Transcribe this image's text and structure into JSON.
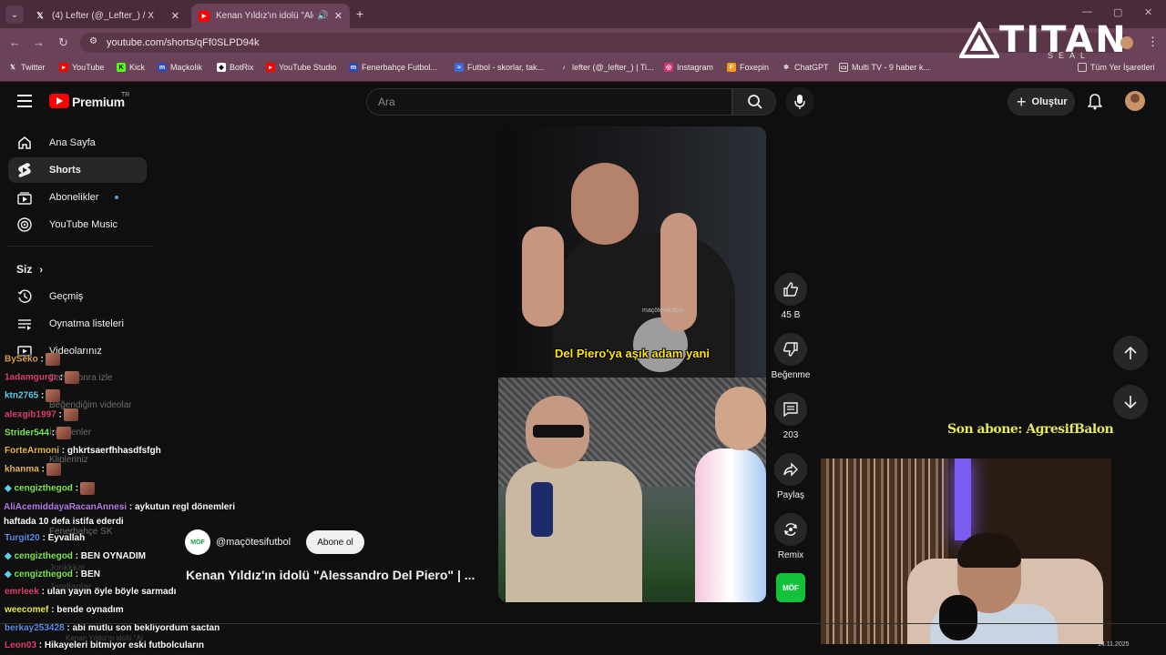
{
  "browser": {
    "tabs": [
      {
        "label": "(4) Lefter (@_Lefter_) / X",
        "favicon": "x-icon"
      },
      {
        "label": "Kenan Yıldız'ın idolü \"Alessa",
        "favicon": "youtube-icon",
        "active": true
      }
    ],
    "url": "youtube.com/shorts/qFf0SLPD94k",
    "bookmarks": [
      {
        "label": "Twitter",
        "icon": "x-icon"
      },
      {
        "label": "YouTube",
        "icon": "youtube-icon"
      },
      {
        "label": "Kick",
        "icon": "kick-icon"
      },
      {
        "label": "Maçkolik",
        "icon": "mackolik-icon"
      },
      {
        "label": "BotRix",
        "icon": "botrix-icon"
      },
      {
        "label": "YouTube Studio",
        "icon": "youtube-icon"
      },
      {
        "label": "Fenerbahçe Futbol...",
        "icon": "mackolik-icon"
      },
      {
        "label": "Futbol - skorlar, tak...",
        "icon": "flashscore-icon"
      },
      {
        "label": "lefter (@_lefter_) | Ti...",
        "icon": "tiktok-icon"
      },
      {
        "label": "Instagram",
        "icon": "instagram-icon"
      },
      {
        "label": "Foxepin",
        "icon": "foxepin-icon"
      },
      {
        "label": "ChatGPT",
        "icon": "chatgpt-icon"
      },
      {
        "label": "Multi TV - 9 haber k...",
        "icon": "multitv-icon"
      }
    ],
    "all_bookmarks": "Tüm Yer İşaretleri"
  },
  "overlay": {
    "brand": "TITAN",
    "brand_sub": "SEAL",
    "last_sub": "Son abone: AgresifBalon"
  },
  "youtube": {
    "logo": "Premium",
    "region": "TR",
    "search_placeholder": "Ara",
    "create_label": "Oluştur",
    "nav": [
      {
        "label": "Ana Sayfa",
        "icon": "home-icon"
      },
      {
        "label": "Shorts",
        "icon": "shorts-icon",
        "active": true
      },
      {
        "label": "Abonelikler",
        "icon": "subscriptions-icon"
      },
      {
        "label": "YouTube Music",
        "icon": "music-icon"
      }
    ],
    "you_header": "Siz",
    "you_items": [
      {
        "label": "Geçmiş",
        "icon": "history-icon"
      },
      {
        "label": "Oynatma listeleri",
        "icon": "playlist-icon"
      },
      {
        "label": "Videolarınız",
        "icon": "videos-icon"
      }
    ],
    "ghost_items": [
      "Daha sonra izle",
      "Beğendiğim videolar",
      "İndirilenler",
      "Klipleriniz",
      "Fenerbahçe SK",
      "Jonkkkar",
      "Jagdlanlar",
      "Kenan Yıldız'ın idolü \"Al"
    ],
    "video": {
      "caption": "Del Piero'ya aşık adam yani",
      "watermark": "maçötesifutbol",
      "channel": "@maçötesifutbol",
      "channel_avatar": "MÖF",
      "subscribe": "Abone ol",
      "title": "Kenan Yıldız'ın idolü \"Alessandro Del Piero\" | ..."
    },
    "actions": [
      {
        "label": "45 B",
        "icon": "like-icon"
      },
      {
        "label": "Beğenme",
        "icon": "dislike-icon"
      },
      {
        "label": "203",
        "icon": "comment-icon"
      },
      {
        "label": "Paylaş",
        "icon": "share-icon"
      },
      {
        "label": "Remix",
        "icon": "remix-icon"
      }
    ]
  },
  "chat": [
    {
      "user": "BySeko",
      "color": "#d9a33a",
      "msg": ":",
      "emote": true
    },
    {
      "user": "1adamgurgr",
      "color": "#e0406c",
      "msg": ":",
      "emote": true
    },
    {
      "user": "ktn2765",
      "color": "#5ad1e8",
      "msg": ":",
      "emote": true
    },
    {
      "user": "alexgib1997",
      "color": "#e0406c",
      "msg": ":",
      "emote": true
    },
    {
      "user": "Strider544",
      "color": "#7ce84a",
      "msg": ":",
      "emote": true
    },
    {
      "user": "ForteArmoni",
      "color": "#e8b84a",
      "msg": ": ghkrtsaerfhhasdfsfgh",
      "emote": false
    },
    {
      "user": "khanma",
      "color": "#e8b84a",
      "msg": ":",
      "emote": true
    },
    {
      "user": "cengizthegod",
      "color": "#7ce84a",
      "msg": ":",
      "emote": true
    },
    {
      "user": "AliAcemiddayaRacanAnnesi",
      "color": "#b77de8",
      "msg": ": aykutun regl dönemleri haftada 10 defa istifa ederdi",
      "emote": false
    },
    {
      "user": "Turgit20",
      "color": "#5a8de8",
      "msg": ": Eyvallah",
      "emote": false
    },
    {
      "user": "cengizthegod",
      "color": "#7ce84a",
      "msg": ": BEN OYNADIM",
      "emote": false
    },
    {
      "user": "cengizthegod",
      "color": "#7ce84a",
      "msg": ": BEN",
      "emote": false
    },
    {
      "user": "emrleek",
      "color": "#e0406c",
      "msg": ": ulan yayın öyle böyle sarmadı",
      "emote": false
    },
    {
      "user": "weecomef",
      "color": "#e8e84a",
      "msg": ": bende oynadım",
      "emote": false
    },
    {
      "user": "berkay253428",
      "color": "#5a8de8",
      "msg": ": abi mutlu son bekliyordum sactan",
      "emote": false
    },
    {
      "user": "Leon03",
      "color": "#e0406c",
      "msg": ": Hikayeleri bitmiyor eski futbolcuların",
      "emote": false
    }
  ],
  "clock": "14.11.2025"
}
